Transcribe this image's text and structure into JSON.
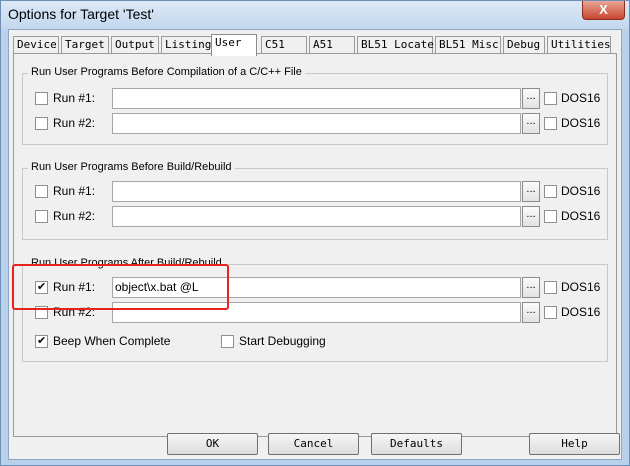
{
  "window": {
    "title": "Options for Target 'Test'",
    "close_label": "X"
  },
  "tabs": [
    {
      "label": "Device"
    },
    {
      "label": "Target"
    },
    {
      "label": "Output"
    },
    {
      "label": "Listing"
    },
    {
      "label": "User",
      "active": true
    },
    {
      "label": "C51"
    },
    {
      "label": "A51"
    },
    {
      "label": "BL51 Locate"
    },
    {
      "label": "BL51 Misc"
    },
    {
      "label": "Debug"
    },
    {
      "label": "Utilities"
    }
  ],
  "groups": {
    "before_compile": {
      "title": "Run User Programs Before Compilation of a C/C++ File",
      "run1": {
        "label": "Run #1:",
        "checked": false,
        "value": "",
        "dos16_label": "DOS16",
        "dos16_checked": false
      },
      "run2": {
        "label": "Run #2:",
        "checked": false,
        "value": "",
        "dos16_label": "DOS16",
        "dos16_checked": false
      }
    },
    "before_build": {
      "title": "Run User Programs Before Build/Rebuild",
      "run1": {
        "label": "Run #1:",
        "checked": false,
        "value": "",
        "dos16_label": "DOS16",
        "dos16_checked": false
      },
      "run2": {
        "label": "Run #2:",
        "checked": false,
        "value": "",
        "dos16_label": "DOS16",
        "dos16_checked": false
      }
    },
    "after_build": {
      "title": "Run User Programs After Build/Rebuild",
      "run1": {
        "label": "Run #1:",
        "checked": true,
        "value": "object\\x.bat @L",
        "dos16_label": "DOS16",
        "dos16_checked": false
      },
      "run2": {
        "label": "Run #2:",
        "checked": false,
        "value": "",
        "dos16_label": "DOS16",
        "dos16_checked": false
      },
      "beep_label": "Beep When Complete",
      "beep_checked": true,
      "start_debug_label": "Start Debugging",
      "start_debug_checked": false
    }
  },
  "browse_label": "...",
  "buttons": {
    "ok": "OK",
    "cancel": "Cancel",
    "defaults": "Defaults",
    "help": "Help"
  },
  "colors": {
    "highlight": "#e8231f",
    "window_frame": "#b9d1ea",
    "dialog_bg": "#f0f0f0"
  }
}
